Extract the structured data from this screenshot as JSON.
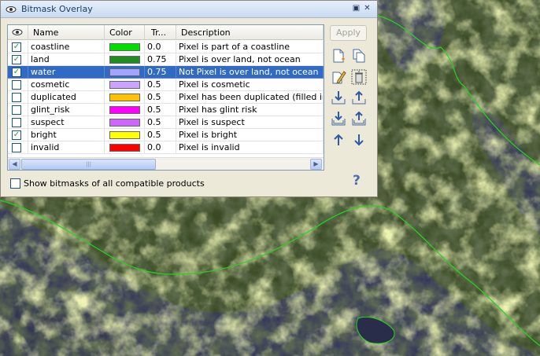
{
  "window": {
    "title": "Bitmask Overlay"
  },
  "table": {
    "columns": [
      "",
      "Name",
      "Color",
      "Tr...",
      "Description"
    ],
    "rows": [
      {
        "visible": true,
        "name": "coastline",
        "color": "#00e000",
        "transparency": "0.0",
        "description": "Pixel is part of a coastline"
      },
      {
        "visible": true,
        "name": "land",
        "color": "#228b22",
        "transparency": "0.75",
        "description": "Pixel is over land, not ocean"
      },
      {
        "visible": true,
        "name": "water",
        "color": "#a4a4ff",
        "transparency": "0.75",
        "description": "Not Pixel is over land, not ocean",
        "selected": true
      },
      {
        "visible": false,
        "name": "cosmetic",
        "color": "#cca4ff",
        "transparency": "0.5",
        "description": "Pixel is cosmetic"
      },
      {
        "visible": false,
        "name": "duplicated",
        "color": "#ffc000",
        "transparency": "0.5",
        "description": "Pixel has been duplicated (filled in)"
      },
      {
        "visible": false,
        "name": "glint_risk",
        "color": "#ff00ff",
        "transparency": "0.5",
        "description": "Pixel has glint risk"
      },
      {
        "visible": false,
        "name": "suspect",
        "color": "#cc66ff",
        "transparency": "0.5",
        "description": "Pixel is suspect"
      },
      {
        "visible": true,
        "name": "bright",
        "color": "#ffff00",
        "transparency": "0.5",
        "description": "Pixel is bright"
      },
      {
        "visible": false,
        "name": "invalid",
        "color": "#ff0000",
        "transparency": "0.0",
        "description": "Pixel is invalid"
      }
    ]
  },
  "buttons": {
    "apply": "Apply",
    "help": "?"
  },
  "options": {
    "show_all_label": "Show bitmasks of all compatible products",
    "show_all_checked": false
  },
  "tools": [
    "new-icon",
    "copy-icon",
    "edit-icon",
    "delete-icon",
    "import-icon",
    "export-icon",
    "import-multiple-icon",
    "export-multiple-icon",
    "move-up-icon",
    "move-down-icon"
  ],
  "colors": {
    "selection": "#316ac5",
    "panel": "#ece9d8",
    "titlebar": "#c8daf1"
  }
}
